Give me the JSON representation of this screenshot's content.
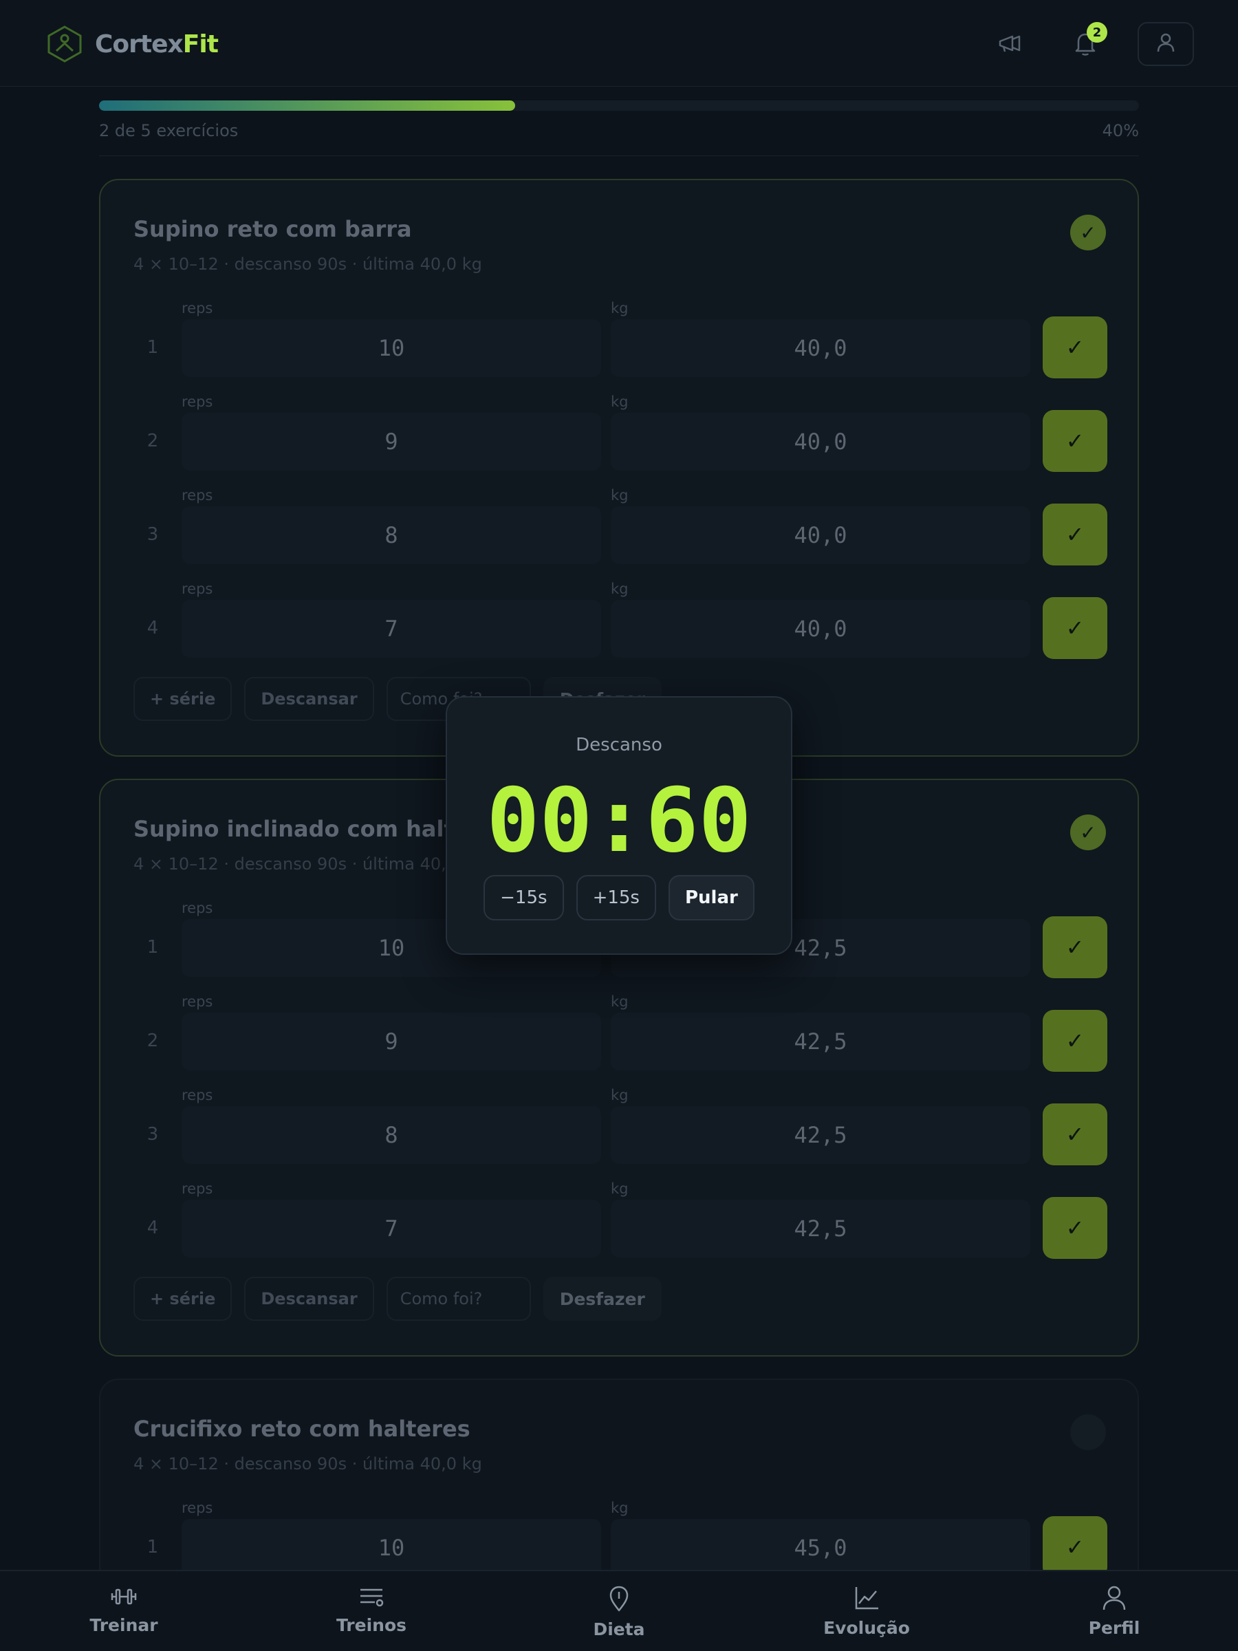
{
  "header": {
    "brand_part1": "Cortex",
    "brand_part2": "Fit",
    "notification_count": "2",
    "icons": [
      "logo-icon",
      "megaphone-icon",
      "bell-icon",
      "user-icon"
    ]
  },
  "progress": {
    "summary": "2 de 5 exercícios",
    "percent_label": "40%",
    "fraction": 0.4
  },
  "exercises": [
    {
      "title": "Supino reto com barra",
      "subtitle": "4 × 10–12 · descanso 90s · última 40,0 kg",
      "done": true,
      "reps_label": "reps",
      "kg_label": "kg",
      "sets": [
        {
          "n": "1",
          "reps": "10",
          "kg": "40,0"
        },
        {
          "n": "2",
          "reps": "9",
          "kg": "40,0"
        },
        {
          "n": "3",
          "reps": "8",
          "kg": "40,0"
        },
        {
          "n": "4",
          "reps": "7",
          "kg": "40,0"
        }
      ],
      "actions": {
        "add_set": "+ série",
        "rest": "Descansar",
        "feedback_placeholder": "Como foi?",
        "undo": "Desfazer"
      }
    },
    {
      "title": "Supino inclinado com halteres",
      "subtitle": "4 × 10–12 · descanso 90s · última 40,0 kg",
      "done": true,
      "reps_label": "reps",
      "kg_label": "kg",
      "sets": [
        {
          "n": "1",
          "reps": "10",
          "kg": "42,5"
        },
        {
          "n": "2",
          "reps": "9",
          "kg": "42,5"
        },
        {
          "n": "3",
          "reps": "8",
          "kg": "42,5"
        },
        {
          "n": "4",
          "reps": "7",
          "kg": "42,5"
        }
      ],
      "actions": {
        "add_set": "+ série",
        "rest": "Descansar",
        "feedback_placeholder": "Como foi?",
        "undo": "Desfazer"
      }
    },
    {
      "title": "Crucifixo reto com halteres",
      "subtitle": "4 × 10–12 · descanso 90s · última 40,0 kg",
      "done": false,
      "reps_label": "reps",
      "kg_label": "kg",
      "sets": [
        {
          "n": "1",
          "reps": "10",
          "kg": "45,0"
        }
      ]
    }
  ],
  "rest_modal": {
    "title": "Descanso",
    "timer": "00:60",
    "minus_label": "−15s",
    "plus_label": "+15s",
    "skip_label": "Pular"
  },
  "bottom_nav": [
    {
      "label": "Treinar",
      "icon": "dumbbell-icon"
    },
    {
      "label": "Treinos",
      "icon": "list-icon"
    },
    {
      "label": "Dieta",
      "icon": "map-pin-icon"
    },
    {
      "label": "Evolução",
      "icon": "chart-line-icon"
    },
    {
      "label": "Perfil",
      "icon": "user-icon"
    }
  ],
  "colors": {
    "accent": "#b4f23e",
    "background": "#0c131b",
    "check_done": "#55711f"
  }
}
